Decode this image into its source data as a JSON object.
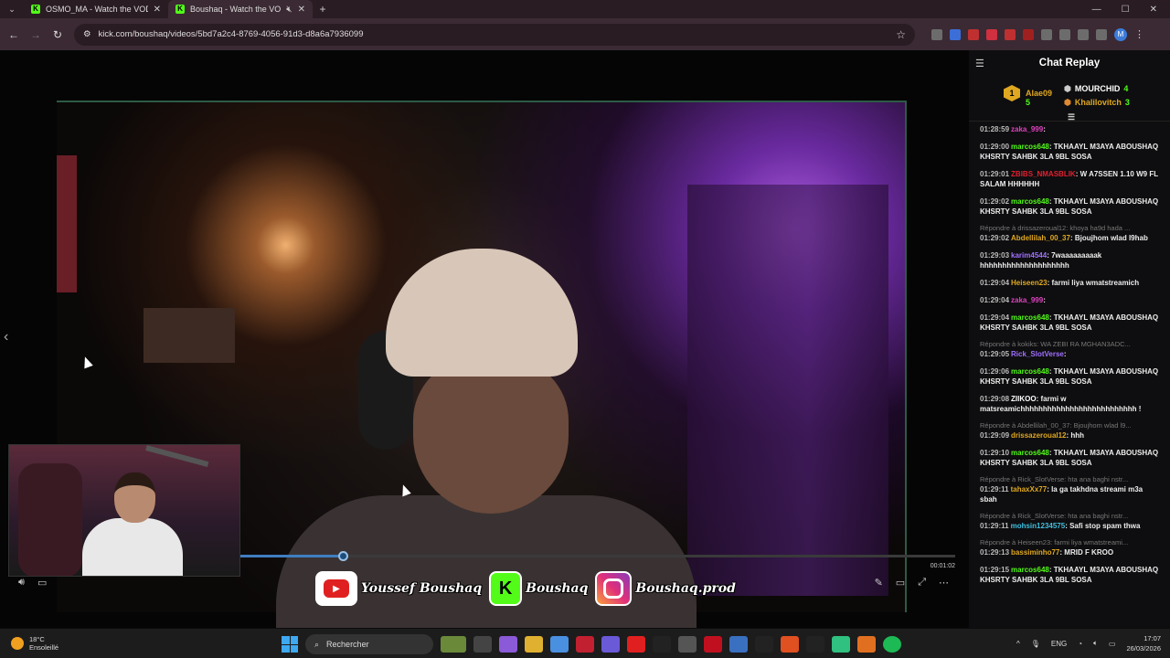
{
  "browser": {
    "tabs": [
      {
        "title": "OSMO_MA - Watch the VOD o",
        "favicon": "K"
      },
      {
        "title": "Boushaq - Watch the VOD",
        "favicon": "K"
      }
    ],
    "url": "kick.com/boushaq/videos/5bd7a2c4-8769-4056-91d3-d8a6a7936099",
    "profile": "M"
  },
  "player": {
    "current_time": "00:01:02",
    "progress": 0.143,
    "socials": {
      "youtube": "Youssef Boushaq",
      "kick": "Boushaq",
      "instagram": "Boushaq.prod"
    }
  },
  "chat": {
    "title": "Chat Replay",
    "leaders": [
      {
        "rank": "1",
        "name": "Alae09",
        "count": "5"
      },
      {
        "name": "MOURCHID",
        "count": "4"
      },
      {
        "name": "Khalilovitch",
        "count": "3"
      }
    ],
    "messages": [
      {
        "time": "01:28:59",
        "user": "zaka_999",
        "color": "#e040c0",
        "text": ":"
      },
      {
        "time": "01:29:00",
        "user": "marcos648",
        "color": "#53fc18",
        "text": ": TKHAAYL M3AYA ABOUSHAQ KHSRTY SAHBK 3LA 9BL SOSA"
      },
      {
        "time": "01:29:01",
        "user": "ZBIBS_NMASBLIK",
        "color": "#e02030",
        "text": ": W A7SSEN 1.10 W9 FL SALAM HHHHHH"
      },
      {
        "time": "01:29:02",
        "user": "marcos648",
        "color": "#53fc18",
        "text": ": TKHAAYL M3AYA ABOUSHAQ KHSRTY SAHBK 3LA 9BL SOSA"
      },
      {
        "reply": "Répondre à drissazeroual12: khoya ha9d hada ...",
        "time": "01:29:02",
        "user": "Abdellilah_00_37",
        "color": "#e0a820",
        "text": ": Bjoujhom wlad l9hab"
      },
      {
        "time": "01:29:03",
        "user": "karim4544",
        "color": "#a070ff",
        "text": ": 7waaaaaaaaak hhhhhhhhhhhhhhhhhhhh"
      },
      {
        "time": "01:29:04",
        "user": "Heiseen23",
        "color": "#e0a820",
        "text": ": farmi liya wmatstreamich"
      },
      {
        "time": "01:29:04",
        "user": "zaka_999",
        "color": "#e040c0",
        "text": ":"
      },
      {
        "time": "01:29:04",
        "user": "marcos648",
        "color": "#53fc18",
        "text": ": TKHAAYL M3AYA ABOUSHAQ KHSRTY SAHBK 3LA 9BL SOSA"
      },
      {
        "reply": "Répondre à kokiks: WA ZEBI RA MGHAN3ADC...",
        "time": "01:29:05",
        "user": "Rick_SlotVerse",
        "color": "#a070ff",
        "text": ":"
      },
      {
        "time": "01:29:06",
        "user": "marcos648",
        "color": "#53fc18",
        "text": ": TKHAAYL M3AYA ABOUSHAQ KHSRTY SAHBK 3LA 9BL SOSA"
      },
      {
        "time": "01:29:08",
        "user": "ZIIKOO",
        "color": "#ffffff",
        "text": ": farmi w matsreamichhhhhhhhhhhhhhhhhhhhhhhhhh !"
      },
      {
        "reply": "Répondre à Abdellilah_00_37: Bjoujhom wlad l9...",
        "time": "01:29:09",
        "user": "drissazeroual12",
        "color": "#e0a820",
        "text": ": hhh"
      },
      {
        "time": "01:29:10",
        "user": "marcos648",
        "color": "#53fc18",
        "text": ": TKHAAYL M3AYA ABOUSHAQ KHSRTY SAHBK 3LA 9BL SOSA"
      },
      {
        "reply": "Répondre à Rick_SlotVerse: hta ana baghi nstr...",
        "time": "01:29:11",
        "user": "tahaxXx77",
        "color": "#e0a820",
        "text": ": la ga takhdna streami m3a sbah"
      },
      {
        "reply": "Répondre à Rick_SlotVerse: hta ana baghi nstr...",
        "time": "01:29:11",
        "user": "mohsin1234575",
        "color": "#40c0e0",
        "text": ": Safi stop spam thwa"
      },
      {
        "reply": "Répondre à Heiseen23: farmi liya wmatstreami...",
        "time": "01:29:13",
        "user": "bassiminho77",
        "color": "#e0a820",
        "text": ": MRID F KROO"
      },
      {
        "time": "01:29:15",
        "user": "marcos648",
        "color": "#53fc18",
        "text": ": TKHAAYL M3AYA ABOUSHAQ KHSRTY SAHBK 3LA 9BL SOSA"
      }
    ]
  },
  "taskbar": {
    "weather_temp": "18°C",
    "weather_desc": "Ensoleillé",
    "search": "Rechercher",
    "lang": "ENG",
    "time": "17:07",
    "date": "26/03/2026"
  }
}
